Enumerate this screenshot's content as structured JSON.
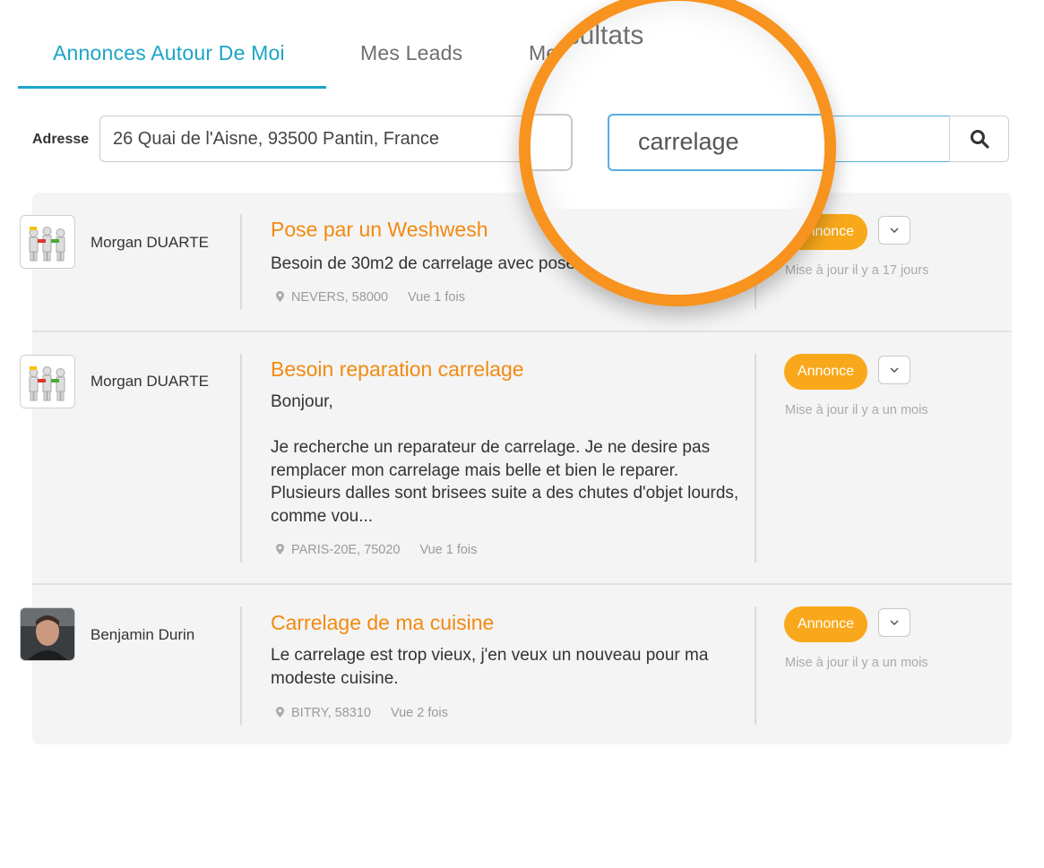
{
  "tabs": [
    {
      "label": "Annonces Autour De Moi",
      "active": true
    },
    {
      "label": "Mes Leads",
      "active": false
    },
    {
      "label": "Mes Resultats",
      "active": false
    }
  ],
  "lens_text": {
    "tab_fragment": "esultats"
  },
  "address": {
    "label": "Adresse",
    "value": "26 Quai de l'Aisne, 93500 Pantin, France"
  },
  "search": {
    "value": "carrelage"
  },
  "accent_colors": {
    "tab": "#1aa5c6",
    "title": "#f28a10",
    "badge": "#f9a81b",
    "lens": "#f7931e"
  },
  "listings": [
    {
      "author": "Morgan DUARTE",
      "avatar": "robots-avatar",
      "title": "Pose par un Weshwesh",
      "description": "Besoin de 30m2 de carrelage avec pose",
      "location": "NEVERS, 58000",
      "views": "Vue 1 fois",
      "badge": "Annonce",
      "updated": "Mise à jour il y a 17 jours"
    },
    {
      "author": "Morgan DUARTE",
      "avatar": "robots-avatar",
      "title": "Besoin reparation carrelage",
      "description": "Bonjour,\n\nJe recherche un reparateur de carrelage. Je ne desire pas remplacer mon carrelage mais belle et bien le reparer. Plusieurs dalles sont brisees suite a des chutes d'objet lourds, comme vou...",
      "location": "PARIS-20E, 75020",
      "views": "Vue 1 fois",
      "badge": "Annonce",
      "updated": "Mise à jour il y a un mois"
    },
    {
      "author": "Benjamin Durin",
      "avatar": "photo-avatar",
      "title": "Carrelage de ma cuisine",
      "description": "Le carrelage est trop vieux, j'en veux un nouveau pour ma modeste cuisine.",
      "location": "BITRY, 58310",
      "views": "Vue 2 fois",
      "badge": "Annonce",
      "updated": "Mise à jour il y a un mois"
    }
  ]
}
